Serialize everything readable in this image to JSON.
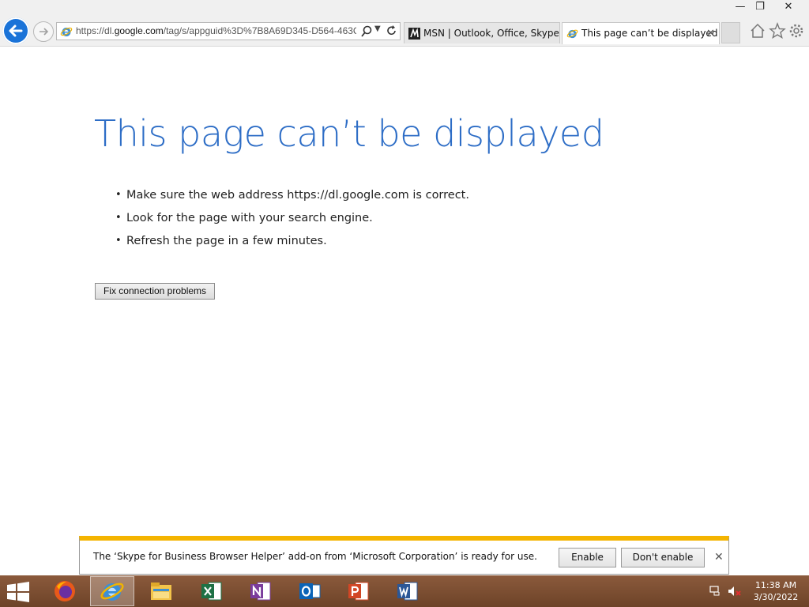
{
  "window": {
    "minimize": "—",
    "restore": "❐",
    "close": "✕"
  },
  "address_bar": {
    "url_prefix": "https://dl.",
    "url_host": "google.com",
    "url_rest": "/tag/s/appguid%3D%7B8A69D345-D564-463C"
  },
  "tabs": [
    {
      "label": "MSN | Outlook, Office, Skype, ...",
      "active": false,
      "icon": "msn-icon"
    },
    {
      "label": "This page can’t be displayed",
      "active": true,
      "icon": "ie-icon"
    }
  ],
  "tab_close": "✕",
  "content": {
    "title": "This page can’t be displayed",
    "bullets": [
      "Make sure the web address https://dl.google.com is correct.",
      "Look for the page with your search engine.",
      "Refresh the page in a few minutes."
    ],
    "fix_button": "Fix connection problems"
  },
  "notification": {
    "message": "The ‘Skype for Business Browser Helper’ add-on from ‘Microsoft Corporation’ is ready for use.",
    "enable": "Enable",
    "dont_enable": "Don't enable",
    "close": "✕"
  },
  "taskbar": {
    "apps": [
      "start",
      "firefox",
      "internet-explorer",
      "file-explorer",
      "excel",
      "onenote",
      "outlook",
      "powerpoint",
      "word"
    ],
    "time": "11:38 AM",
    "date": "3/30/2022"
  },
  "colors": {
    "title_blue": "#2d6dc6",
    "back_button": "#1a73d8",
    "notification_accent": "#f4b400",
    "taskbar": "#7a4d30"
  }
}
